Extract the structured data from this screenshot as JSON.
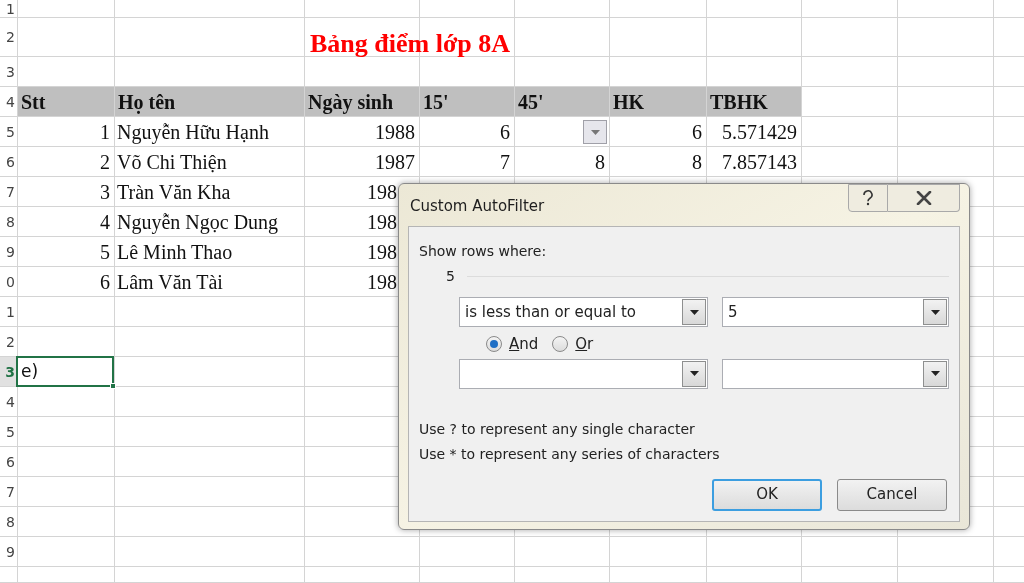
{
  "sheet": {
    "row_headers": [
      {
        "label": "1",
        "selected": false
      },
      {
        "label": "2",
        "selected": false
      },
      {
        "label": "3",
        "selected": false
      },
      {
        "label": "4",
        "selected": false
      },
      {
        "label": "5",
        "selected": false
      },
      {
        "label": "6",
        "selected": false
      },
      {
        "label": "7",
        "selected": false
      },
      {
        "label": "8",
        "selected": false
      },
      {
        "label": "9",
        "selected": false
      },
      {
        "label": "0",
        "selected": false
      },
      {
        "label": "1",
        "selected": false
      },
      {
        "label": "2",
        "selected": false
      },
      {
        "label": "3",
        "selected": true
      },
      {
        "label": "4",
        "selected": false
      },
      {
        "label": "5",
        "selected": false
      },
      {
        "label": "6",
        "selected": false
      },
      {
        "label": "7",
        "selected": false
      },
      {
        "label": "8",
        "selected": false
      },
      {
        "label": "9",
        "selected": false
      }
    ],
    "title": "Bảng điểm lớp 8A",
    "columns": [
      "Stt",
      "Họ tên",
      "Ngày sinh",
      "15'",
      "45'",
      "HK",
      "TBHK"
    ],
    "rows": [
      {
        "cells": [
          "1",
          "Nguyễn Hữu Hạnh",
          "1988",
          "6",
          "",
          "6",
          "5.571429"
        ],
        "filter_dropdown": true
      },
      {
        "cells": [
          "2",
          "Võ Chi Thiện",
          "1987",
          "7",
          "8",
          "8",
          "7.857143"
        ]
      },
      {
        "cells": [
          "3",
          "Tràn Văn Kha",
          "198"
        ],
        "cut": true
      },
      {
        "cells": [
          "4",
          "Nguyễn Ngọc Dung",
          "198"
        ],
        "cut": true
      },
      {
        "cells": [
          "5",
          "Lê Minh Thao",
          "198"
        ],
        "cut": true
      },
      {
        "cells": [
          "6",
          "Lâm Văn Tài",
          "198"
        ],
        "cut": true
      }
    ],
    "active_cell": {
      "value": "e)"
    }
  },
  "dialog": {
    "title": "Custom AutoFilter",
    "group_label": "Show rows where:",
    "field_name": "5",
    "conditions": [
      {
        "operator": "is less than or equal to",
        "value": "5",
        "kind": "filled"
      },
      {
        "kind": "blank"
      }
    ],
    "logic": [
      {
        "label": "And",
        "selected": true
      },
      {
        "label": "Or",
        "selected": false
      }
    ],
    "hints": [
      "Use ? to represent any single character",
      "Use * to represent any series of characters"
    ],
    "buttons": [
      {
        "label": "OK",
        "default": true
      },
      {
        "label": "Cancel",
        "default": false
      }
    ]
  }
}
